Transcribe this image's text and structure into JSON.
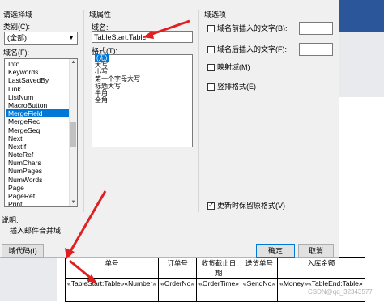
{
  "dialog": {
    "left_panel": {
      "choose_field": "请选择域",
      "category_label": "类别(C):",
      "category_value": "(全部)",
      "field_names_label": "域名(F):",
      "field_names": [
        "Info",
        "Keywords",
        "LastSavedBy",
        "Link",
        "ListNum",
        "MacroButton",
        "MergeField",
        "MergeRec",
        "MergeSeq",
        "Next",
        "NextIf",
        "NoteRef",
        "NumChars",
        "NumPages",
        "NumWords",
        "Page",
        "PageRef",
        "Print"
      ],
      "selected_field": "MergeField",
      "description_label": "说明:",
      "description_text": "插入邮件合并域",
      "field_codes_button": "域代码(I)"
    },
    "properties": {
      "title": "域属性",
      "field_name_label": "域名:",
      "field_name_value": "TableStart:Table",
      "format_label": "格式(T):",
      "formats": [
        "(无)",
        "大写",
        "小写",
        "第一个字母大写",
        "标题大写",
        "半角",
        "全角"
      ],
      "selected_format": "(无)"
    },
    "options": {
      "title": "域选项",
      "text_before_label": "域名前插入的文字(B):",
      "text_after_label": "域名后插入的文字(F):",
      "mapped_label": "映射域(M)",
      "vertical_label": "竖排格式(E)",
      "preserve_label": "更新时保留原格式(V)",
      "preserve_checked": true
    },
    "ok_button": "确定",
    "cancel_button": "取消"
  },
  "document": {
    "header_row": [
      "单号",
      "订单号",
      "收货截止日期",
      "送货单号",
      "入库金额"
    ],
    "data_row": [
      "«TableStart:Table»«Number»",
      "«OrderNo»",
      "«OrderTime»",
      "«SendNo»",
      "«Money»«TableEnd:Table»"
    ]
  },
  "watermark": "CSDN@qq_32343577",
  "colors": {
    "selection": "#0078d7",
    "arrow": "#e02020",
    "ribbon": "#2b579a"
  }
}
